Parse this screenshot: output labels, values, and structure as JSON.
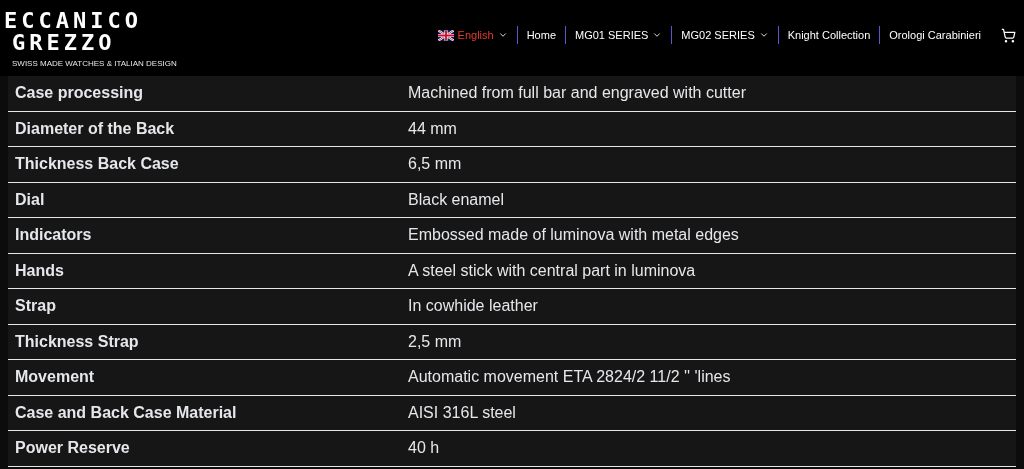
{
  "header": {
    "logo": {
      "line_1": "ECCANICO",
      "line_2": "GREZZO",
      "tagline": "SWISS MADE WATCHES & ITALIAN DESIGN"
    },
    "nav": [
      {
        "label": "English",
        "kind": "language",
        "dropdown": true
      },
      {
        "label": "Home",
        "kind": "link",
        "dropdown": false
      },
      {
        "label": "MG01 SERIES",
        "kind": "link",
        "dropdown": true
      },
      {
        "label": "MG02 SERIES",
        "kind": "link",
        "dropdown": true
      },
      {
        "label": "Knight Collection",
        "kind": "link",
        "dropdown": false
      },
      {
        "label": "Orologi Carabinieri",
        "kind": "link",
        "dropdown": false
      }
    ]
  },
  "specs": [
    {
      "label": "Case processing",
      "value": "Machined from full bar and engraved with cutter"
    },
    {
      "label": "Diameter of the Back",
      "value": "44 mm"
    },
    {
      "label": "Thickness Back Case",
      "value": "6,5 mm"
    },
    {
      "label": "Dial",
      "value": "Black enamel"
    },
    {
      "label": "Indicators",
      "value": "Embossed made of luminova with metal edges"
    },
    {
      "label": "Hands",
      "value": "A steel stick with central part in luminova"
    },
    {
      "label": "Strap",
      "value": "In cowhide leather"
    },
    {
      "label": "Thickness Strap",
      "value": "2,5 mm"
    },
    {
      "label": "Movement",
      "value": "Automatic movement ETA 2824/2 11/2 '' 'lines"
    },
    {
      "label": "Case and Back Case Material",
      "value": "AISI 316L steel"
    },
    {
      "label": "Power Reserve",
      "value": "40 h"
    }
  ]
}
